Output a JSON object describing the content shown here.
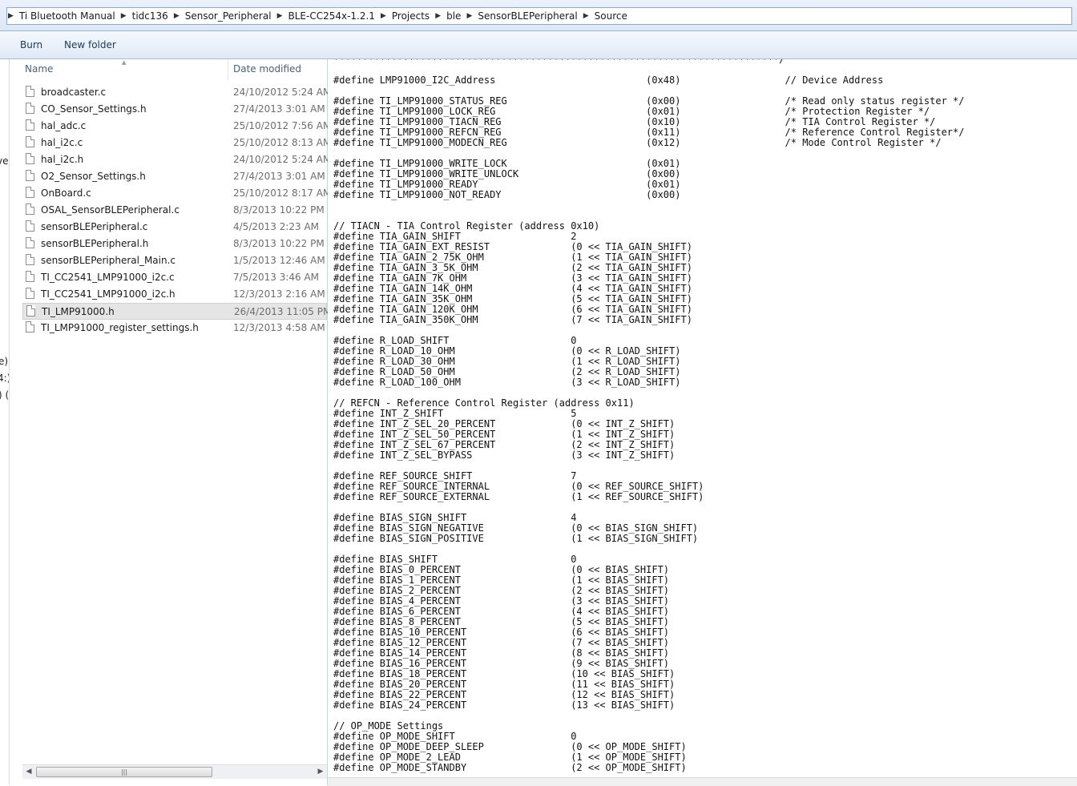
{
  "breadcrumb": [
    "Ti Bluetooth Manual",
    "tidc136",
    "Sensor_Peripheral",
    "BLE-CC254x-1.2.1",
    "Projects",
    "ble",
    "SensorBLEPeripheral",
    "Source"
  ],
  "toolbar": {
    "burn_label": "Burn",
    "new_folder_label": "New folder"
  },
  "nav_fragments": [
    "ve",
    "e)",
    "4:)",
    ") ("
  ],
  "columns": {
    "name": "Name",
    "date_modified": "Date modified"
  },
  "files": [
    {
      "name": "broadcaster.c",
      "date": "24/10/2012 5:24 AM"
    },
    {
      "name": "CO_Sensor_Settings.h",
      "date": "27/4/2013 3:01 AM"
    },
    {
      "name": "hal_adc.c",
      "date": "25/10/2012 7:56 AM"
    },
    {
      "name": "hal_i2c.c",
      "date": "25/10/2012 8:13 AM"
    },
    {
      "name": "hal_i2c.h",
      "date": "24/10/2012 5:24 AM"
    },
    {
      "name": "O2_Sensor_Settings.h",
      "date": "27/4/2013 3:01 AM"
    },
    {
      "name": "OnBoard.c",
      "date": "25/10/2012 8:17 AM"
    },
    {
      "name": "OSAL_SensorBLEPeripheral.c",
      "date": "8/3/2013 10:22 PM"
    },
    {
      "name": "sensorBLEPeripheral.c",
      "date": "4/5/2013 2:23 AM"
    },
    {
      "name": "sensorBLEPeripheral.h",
      "date": "8/3/2013 10:22 PM"
    },
    {
      "name": "sensorBLEPeripheral_Main.c",
      "date": "1/5/2013 12:46 AM"
    },
    {
      "name": "TI_CC2541_LMP91000_i2c.c",
      "date": "7/5/2013 3:46 AM"
    },
    {
      "name": "TI_CC2541_LMP91000_i2c.h",
      "date": "12/3/2013 2:16 AM"
    },
    {
      "name": "TI_LMP91000.h",
      "date": "26/4/2013 11:05 PM",
      "selected": true
    },
    {
      "name": "TI_LMP91000_register_settings.h",
      "date": "12/3/2013 4:58 AM"
    }
  ],
  "code_lines": [
    "*****************************************************************************/",
    "",
    "#define LMP91000_I2C_Address                          (0x48)                  // Device Address",
    "",
    "#define TI_LMP91000_STATUS_REG                        (0x00)                  /* Read only status register */",
    "#define TI_LMP91000_LOCK_REG                          (0x01)                  /* Protection Register */",
    "#define TI_LMP91000_TIACN_REG                         (0x10)                  /* TIA Control Register */",
    "#define TI_LMP91000_REFCN_REG                         (0x11)                  /* Reference Control Register*/",
    "#define TI_LMP91000_MODECN_REG                        (0x12)                  /* Mode Control Register */",
    "",
    "#define TI_LMP91000_WRITE_LOCK                        (0x01)",
    "#define TI_LMP91000_WRITE_UNLOCK                      (0x00)",
    "#define TI_LMP91000_READY                             (0x01)",
    "#define TI_LMP91000_NOT_READY                         (0x00)",
    "",
    "",
    "// TIACN - TIA Control Register (address 0x10)",
    "#define TIA_GAIN_SHIFT                   2",
    "#define TIA_GAIN_EXT_RESIST              (0 << TIA_GAIN_SHIFT)",
    "#define TIA_GAIN_2_75K_OHM               (1 << TIA_GAIN_SHIFT)",
    "#define TIA_GAIN_3_5K_OHM                (2 << TIA_GAIN_SHIFT)",
    "#define TIA_GAIN_7K_OHM                  (3 << TIA_GAIN_SHIFT)",
    "#define TIA_GAIN_14K_OHM                 (4 << TIA_GAIN_SHIFT)",
    "#define TIA_GAIN_35K_OHM                 (5 << TIA_GAIN_SHIFT)",
    "#define TIA_GAIN_120K_OHM                (6 << TIA_GAIN_SHIFT)",
    "#define TIA_GAIN_350K_OHM                (7 << TIA_GAIN_SHIFT)",
    "",
    "#define R_LOAD_SHIFT                     0",
    "#define R_LOAD_10_OHM                    (0 << R_LOAD_SHIFT)",
    "#define R_LOAD_30_OHM                    (1 << R_LOAD_SHIFT)",
    "#define R_LOAD_50_OHM                    (2 << R_LOAD_SHIFT)",
    "#define R_LOAD_100_OHM                   (3 << R_LOAD_SHIFT)",
    "",
    "// REFCN - Reference Control Register (address 0x11)",
    "#define INT_Z_SHIFT                      5",
    "#define INT_Z_SEL_20_PERCENT             (0 << INT_Z_SHIFT)",
    "#define INT_Z_SEL_50_PERCENT             (1 << INT_Z_SHIFT)",
    "#define INT_Z_SEL_67_PERCENT             (2 << INT_Z_SHIFT)",
    "#define INT_Z_SEL_BYPASS                 (3 << INT_Z_SHIFT)",
    "",
    "#define REF_SOURCE_SHIFT                 7",
    "#define REF_SOURCE_INTERNAL              (0 << REF_SOURCE_SHIFT)",
    "#define REF_SOURCE_EXTERNAL              (1 << REF_SOURCE_SHIFT)",
    "",
    "#define BIAS_SIGN_SHIFT                  4",
    "#define BIAS_SIGN_NEGATIVE               (0 << BIAS_SIGN_SHIFT)",
    "#define BIAS_SIGN_POSITIVE               (1 << BIAS_SIGN_SHIFT)",
    "",
    "#define BIAS_SHIFT                       0",
    "#define BIAS_0_PERCENT                   (0 << BIAS_SHIFT)",
    "#define BIAS_1_PERCENT                   (1 << BIAS_SHIFT)",
    "#define BIAS_2_PERCENT                   (2 << BIAS_SHIFT)",
    "#define BIAS_4_PERCENT                   (3 << BIAS_SHIFT)",
    "#define BIAS_6_PERCENT                   (4 << BIAS_SHIFT)",
    "#define BIAS_8_PERCENT                   (5 << BIAS_SHIFT)",
    "#define BIAS_10_PERCENT                  (6 << BIAS_SHIFT)",
    "#define BIAS_12_PERCENT                  (7 << BIAS_SHIFT)",
    "#define BIAS_14_PERCENT                  (8 << BIAS_SHIFT)",
    "#define BIAS_16_PERCENT                  (9 << BIAS_SHIFT)",
    "#define BIAS_18_PERCENT                  (10 << BIAS_SHIFT)",
    "#define BIAS_20_PERCENT                  (11 << BIAS_SHIFT)",
    "#define BIAS_22_PERCENT                  (12 << BIAS_SHIFT)",
    "#define BIAS_24_PERCENT                  (13 << BIAS_SHIFT)",
    "",
    "// OP_MODE Settings",
    "#define OP_MODE_SHIFT                    0",
    "#define OP_MODE_DEEP_SLEEP               (0 << OP_MODE_SHIFT)",
    "#define OP_MODE_2_LEAD                   (1 << OP_MODE_SHIFT)",
    "#define OP_MODE_STANDBY                  (2 << OP_MODE_SHIFT)"
  ]
}
